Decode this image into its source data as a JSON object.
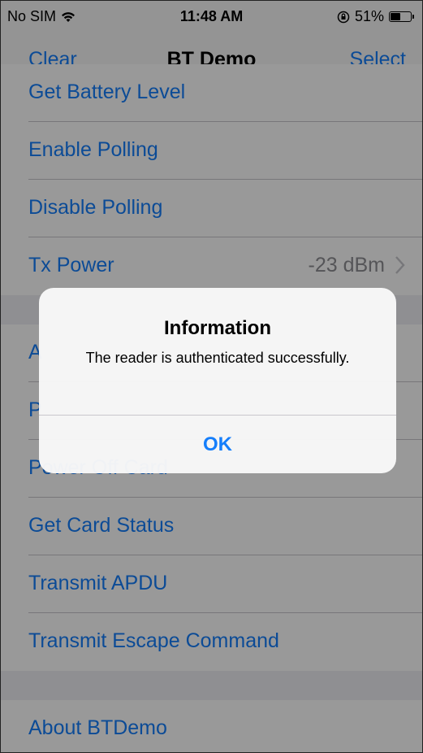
{
  "status_bar": {
    "carrier": "No SIM",
    "time": "11:48 AM",
    "battery_percent": "51%",
    "battery_level": 0.51,
    "icons": [
      "wifi-icon",
      "orientation-lock-icon",
      "battery-icon"
    ]
  },
  "nav": {
    "left_label": "Clear",
    "title": "BT Demo",
    "right_label": "Select"
  },
  "table": {
    "group1": [
      {
        "label": "Get Battery Level"
      },
      {
        "label": "Enable Polling"
      },
      {
        "label": "Disable Polling"
      },
      {
        "label": "Tx Power",
        "detail": "-23 dBm"
      }
    ],
    "group2": [
      {
        "label": "A"
      },
      {
        "label": "P"
      },
      {
        "label": "Power Off Card"
      },
      {
        "label": "Get Card Status"
      },
      {
        "label": "Transmit APDU"
      },
      {
        "label": "Transmit Escape Command"
      }
    ],
    "group3": [
      {
        "label": "About BTDemo"
      }
    ]
  },
  "alert": {
    "title": "Information",
    "message": "The reader is authenticated successfully.",
    "button": "OK"
  },
  "colors": {
    "accent": "#157efb",
    "separator": "#c8c7cc",
    "group_background": "#efeff4"
  }
}
